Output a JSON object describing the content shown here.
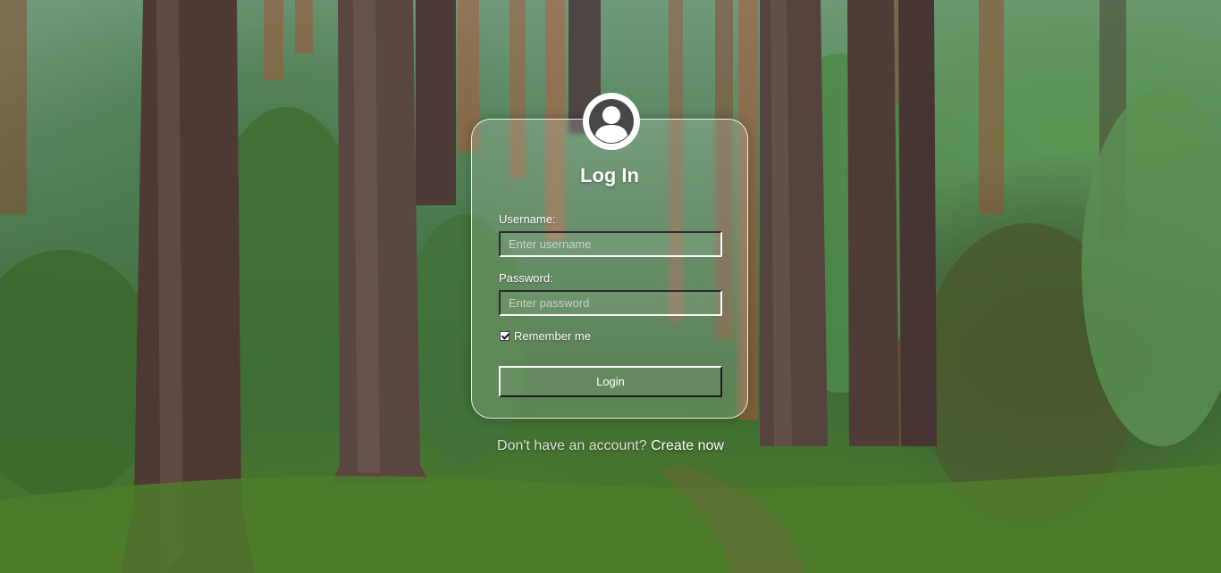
{
  "login": {
    "title": "Log In",
    "username_label": "Username:",
    "username_placeholder": "Enter username",
    "password_label": "Password:",
    "password_placeholder": "Enter password",
    "remember_label": "Remember me",
    "remember_checked": true,
    "login_button": "Login"
  },
  "signup": {
    "prompt": "Don't have an account?",
    "link": "Create now"
  },
  "icons": {
    "avatar": "user-avatar-icon"
  },
  "colors": {
    "text": "#ffffff",
    "card_border": "#ffffff"
  }
}
